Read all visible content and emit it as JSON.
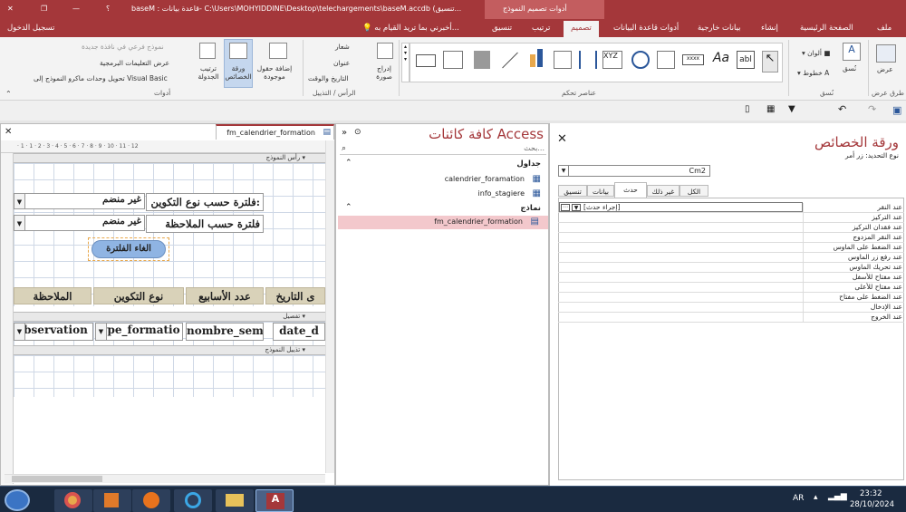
{
  "titlebar": {
    "help": "؟",
    "path": "baseM : قاعدة بيانات- C:\\Users\\MOHYIDDINE\\Desktop\\telechargements\\baseM.accdb (تنسيق...",
    "context_tab": "أدوات تصميم النموذج",
    "minimize": "—",
    "restore": "❐",
    "close": "✕"
  },
  "tabs": {
    "file": "ملف",
    "home": "الصفحة الرئيسية",
    "create": "إنشاء",
    "external": "بيانات خارجية",
    "dbtools": "أدوات قاعدة البيانات",
    "design": "تصميم",
    "arrange": "ترتيب",
    "format": "تنسيق",
    "tellme": "أخبرني بما تريد القيام به...",
    "signin": "تسجيل الدخول"
  },
  "ribbon": {
    "view": "عرض",
    "views_group": "طرق عرض",
    "theme": "نُسق",
    "colors": "ألوان",
    "fonts": "خطوط",
    "themes_group": "نُسق",
    "controls_group": "عناصر تحكم",
    "insert_image": "إدراج صورة",
    "logo": "شعار",
    "title": "عنوان",
    "datetime": "التاريخ والوقت",
    "header_group": "الرأس / التذييل",
    "add_fields": "إضافة حقول موجودة",
    "property_sheet": "ورقة الخصائص",
    "tab_order": "ترتيب الجدولة",
    "subform": "نموذج فرعي في نافذة جديدة",
    "view_code": "عرض التعليمات البرمجية",
    "convert_macros": "تحويل وحدات ماكرو النموذج إلى Visual Basic",
    "tools_group": "أدوات",
    "aa": "Aa",
    "abl": "abl",
    "xxxx": "xxxx",
    "xyz": "XYZ"
  },
  "form": {
    "tab_title": "fm_calendrier_formation",
    "ruler": "· 1 · 1 · 2 · 3 · 4 · 5 · 6 · 7 · 8 · 9 · 10 · 11 · 12",
    "sec_header": "رأس النموذج",
    "sec_detail": "تفصيل",
    "sec_footer": "تذييل النموذج",
    "filter_type_label": "فلترة حسب نوع التكوين:",
    "filter_type_value": "غير منضم",
    "filter_obs_label": "فلترة حسب الملاحظة",
    "filter_obs_value": "غير منضم",
    "cancel_filter": "الغاء الفلترة",
    "col_date": "ى التاريخ",
    "col_weeks": "عدد الأسابيع",
    "col_type": "نوع التكوين",
    "col_obs": "الملاحظة",
    "fld_date": "date_d",
    "fld_weeks": "nombre_semai",
    "fld_type": "type_formatio",
    "fld_obs": "observation"
  },
  "nav": {
    "title": "كافة كائنات Access",
    "search_placeholder": "بحث...",
    "tables_group": "جداول",
    "table1": "calendrier_foramation",
    "table2": "info_stagiere",
    "forms_group": "نماذج",
    "form1": "fm_calendrier_formation"
  },
  "props": {
    "title": "ورقة الخصائص",
    "selection_type": "نوع التحديد: زر أمر",
    "selected": "Cm2",
    "tab_format": "تنسيق",
    "tab_data": "بيانات",
    "tab_event": "حدث",
    "tab_other": "غير ذلك",
    "tab_all": "الكل",
    "on_click_value": "[إجراء حدث]",
    "rows": [
      "عند النقر",
      "عند التركيز",
      "عند فقدان التركيز",
      "عند النقر المزدوج",
      "عند الضغط على الماوس",
      "عند رفع زر الماوس",
      "عند تحريك الماوس",
      "عند مفتاح للأسفل",
      "عند مفتاح للأعلى",
      "عند الضغط على مفتاح",
      "عند الإدخال",
      "عند الخروج"
    ]
  },
  "qat": {
    "undo": "↶",
    "redo": "↷",
    "filter": "▼"
  },
  "taskbar": {
    "lang": "AR",
    "time": "23:32",
    "date": "28/10/2024"
  },
  "colors": {
    "accent": "#a4373a",
    "tab_header": "#d9d2b9",
    "button": "#8fb4e3"
  }
}
